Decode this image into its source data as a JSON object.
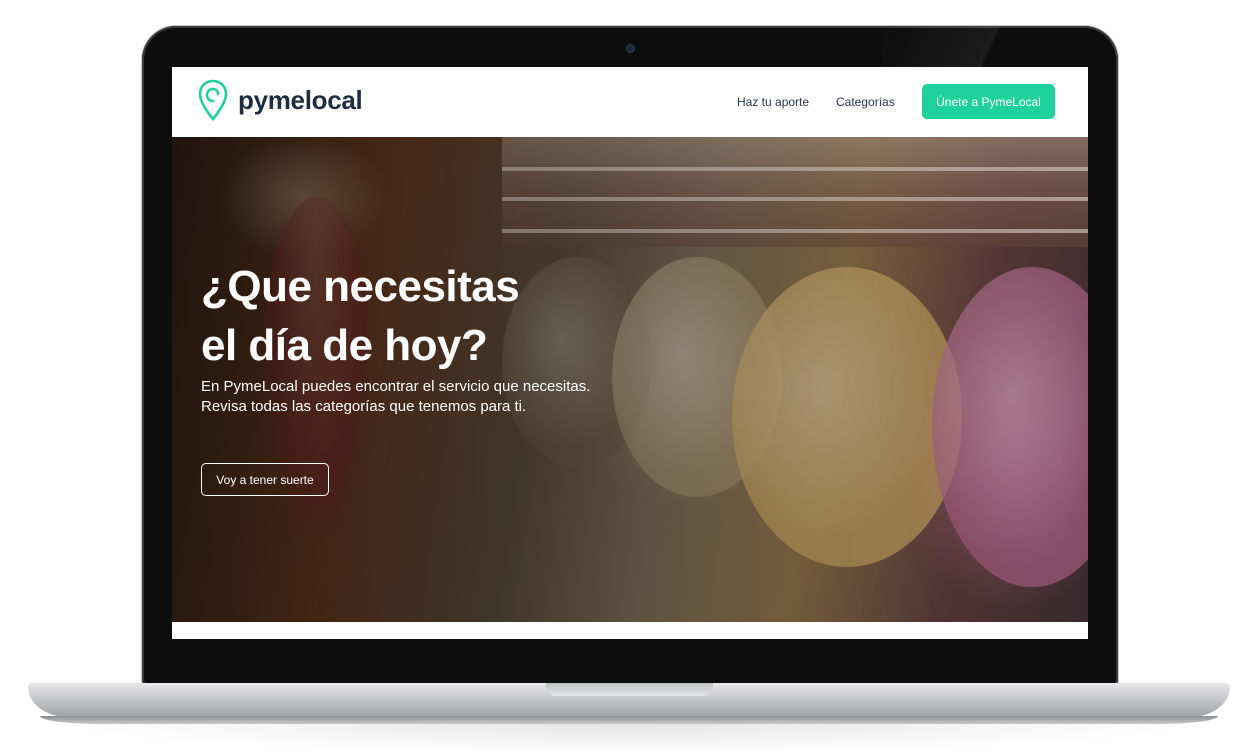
{
  "brand": {
    "name": "pymelocal",
    "accent_color": "#1fd19a",
    "text_color": "#1f2d44",
    "logo_icon": "location-pin-icon"
  },
  "nav": {
    "links": [
      {
        "label": "Haz tu aporte"
      },
      {
        "label": "Categorías"
      }
    ],
    "cta_label": "Únete a PymeLocal"
  },
  "hero": {
    "title_line1": "¿Que necesitas",
    "title_line2": "el día de hoy?",
    "subtitle_line1": "En PymeLocal puedes encontrar el servicio que necesitas.",
    "subtitle_line2": "Revisa todas las categorías que tenemos para ti.",
    "button_label": "Voy a tener suerte"
  }
}
